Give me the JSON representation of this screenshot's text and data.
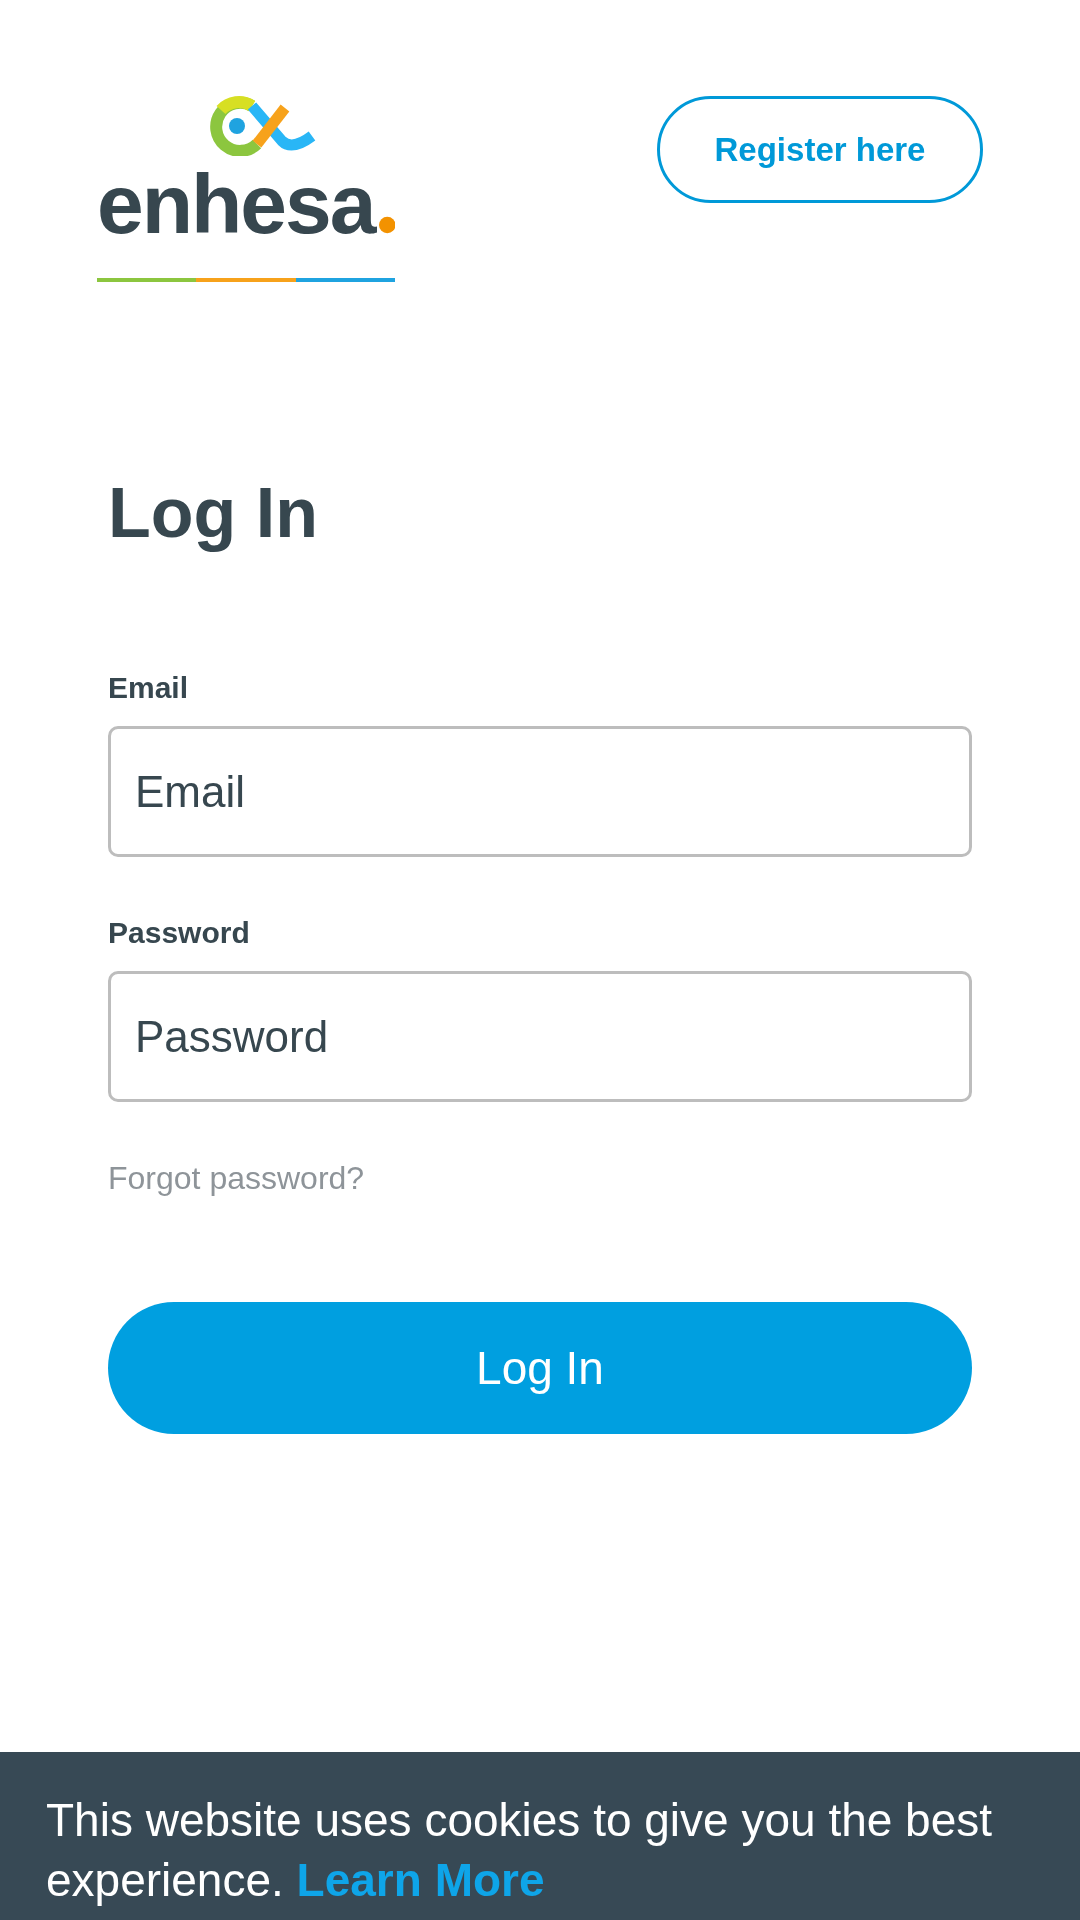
{
  "header": {
    "logo": {
      "wordmark": "enhesa"
    },
    "register_button": "Register here"
  },
  "form": {
    "title": "Log In",
    "fields": [
      {
        "label": "Email",
        "placeholder": "Email"
      },
      {
        "label": "Password",
        "placeholder": "Password"
      }
    ],
    "forgot_link": "Forgot password?",
    "submit_button": "Log In"
  },
  "cookie_banner": {
    "text": "This website uses cookies to give you the best experience.",
    "link": "Learn More"
  }
}
